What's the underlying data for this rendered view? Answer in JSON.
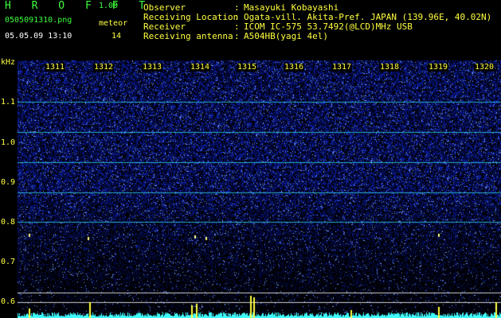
{
  "header": {
    "app_title": "H R O F F T",
    "version": "1.00",
    "filename": "0505091310.png",
    "datetime": "05.05.09 13:10",
    "meteor_label": "meteor",
    "meteor_count": "14",
    "info": [
      {
        "key": "Observer",
        "sep": ":",
        "value": "Masayuki Kobayashi"
      },
      {
        "key": "Receiving Location",
        "sep": ":",
        "value": "Ogata-vill. Akita-Pref. JAPAN (139.96E, 40.02N)"
      },
      {
        "key": "Receiver",
        "sep": ":",
        "value": "ICOM IC-575 53.7492(@LCD)MHz USB"
      },
      {
        "key": "Receiving antenna",
        "sep": ":",
        "value": "A504HB(yagi 4el)"
      }
    ]
  },
  "axis": {
    "unit": "kHz",
    "y_ticks": [
      "1.1",
      "1.0",
      "0.9",
      "0.8",
      "0.7",
      "0.6"
    ],
    "time_ticks": [
      "1311",
      "1312",
      "1313",
      "1314",
      "1315",
      "1316",
      "1317",
      "1318",
      "1319",
      "1320"
    ]
  },
  "colors": {
    "background": "#000000",
    "accent_green": "#3cff3c",
    "label_yellow": "#ffff40",
    "signal_cyan": "#40ffff",
    "noise_blue": "#1030c0"
  }
}
